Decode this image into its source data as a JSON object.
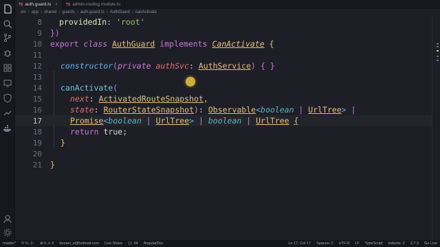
{
  "tabs": [
    {
      "icon": "TS",
      "label": "auth.guard.ts",
      "close": "×"
    },
    {
      "icon": "TS",
      "label": "admin-routing.module.ts"
    }
  ],
  "breadcrumb": [
    "src",
    "app",
    "shared",
    "guards",
    "auth.guard.ts",
    "AuthGuard",
    "canActivate"
  ],
  "line_numbers": [
    "8",
    "9",
    "10",
    "11",
    "12",
    "13",
    "14",
    "15",
    "16",
    "17",
    "18",
    "19",
    "20",
    "21"
  ],
  "code": {
    "l8_prop": "providedIn",
    "l8_colon": ": ",
    "l8_str": "'root'",
    "l9": "})",
    "l10_export": "export",
    "l10_class": "class",
    "l10_name": "AuthGuard",
    "l10_impl": "implements",
    "l10_iface": "CanActivate",
    "l10_brace": "{",
    "l12_ctor": "constructor",
    "l12_open": "(",
    "l12_private": "private",
    "l12_param": "authSvc",
    "l12_colon": ": ",
    "l12_type": "AuthService",
    "l12_close": ")",
    "l12_body": "{ }",
    "l14_method": "canActivate",
    "l14_open": "(",
    "l15_param": "next",
    "l15_colon": ": ",
    "l15_type": "ActivatedRouteSnapshot",
    "l15_comma": ",",
    "l16_param": "state",
    "l16_colon": ": ",
    "l16_type": "RouterStateSnapshot",
    "l16_close": ")",
    "l16_colon2": ": ",
    "l16_obs": "Observable",
    "l16_lt": "<",
    "l16_bool": "boolean",
    "l16_pipe": " | ",
    "l16_urltree": "UrlTree",
    "l16_gt": ">",
    "l16_pipe2": " |",
    "l17_promise": "Promise",
    "l17_lt": "<",
    "l17_bool": "boolean",
    "l17_pipe": " | ",
    "l17_urltree": "UrlTree",
    "l17_gt": ">",
    "l17_pipe2": " | ",
    "l17_bool2": "boolean",
    "l17_pipe3": " | ",
    "l17_urltree2": "UrlTree",
    "l17_brace": "{",
    "l17b_return": "return",
    "l17b_true": "true",
    "l17b_semi": ";",
    "l18": "}",
    "l20": "}"
  },
  "status_bar": {
    "branch": "master*",
    "sync": "⟳ 0↓ 1↑",
    "errors": "⊗ 0 ⚠ 0",
    "user": "bezael_e@hotmail.com",
    "live_share": "Live Share",
    "selection": "{.}: 94",
    "framework": "AngularDoc",
    "position": "Ln 17, Col 17",
    "spaces": "Spaces: 2",
    "encoding": "UTF-8",
    "eol": "LF",
    "language": "TypeScript",
    "indent": "Indents: 2",
    "version": "3.7.3",
    "go_live": "Go Live"
  },
  "colors": {
    "background": "#1e1f26",
    "keyword": "#c678dd",
    "class": "#e5c07b",
    "string": "#98c379",
    "highlight_dot": "#f0c83c"
  }
}
